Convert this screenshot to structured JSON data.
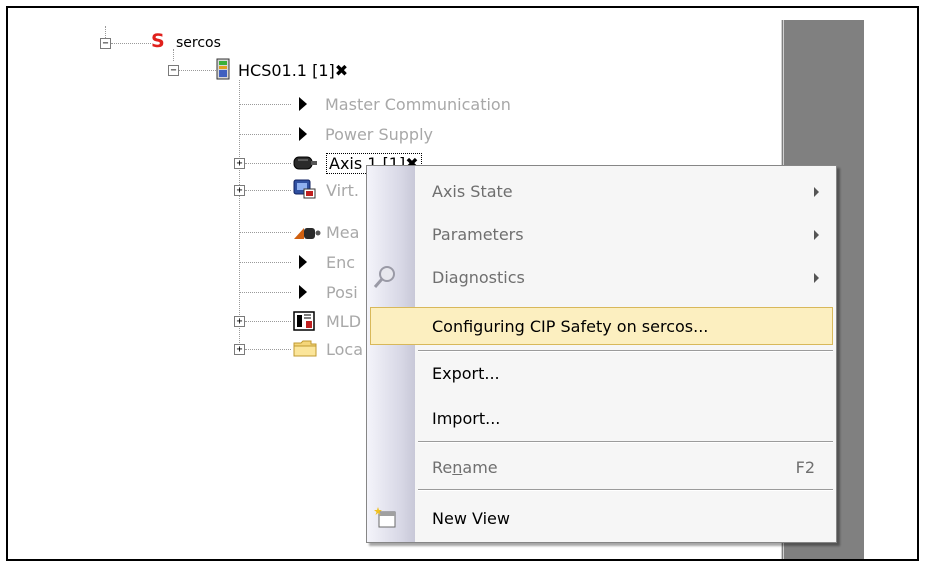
{
  "tree": {
    "root": {
      "icon": "sercos-s-icon",
      "label": "sercos",
      "icon_color": "#e0201c"
    },
    "drive": {
      "icon": "drive-device-icon",
      "label": "HCS01.1 [1]✖"
    },
    "children": [
      {
        "id": "master",
        "icon": "arrow-right-icon",
        "label": "Master Communication",
        "dim": true
      },
      {
        "id": "power",
        "icon": "arrow-right-icon",
        "label": "Power Supply",
        "dim": true
      },
      {
        "id": "axis",
        "icon": "motor-icon",
        "label": "Axis 1 [1]✖",
        "dim": false,
        "selected": true
      },
      {
        "id": "virt",
        "icon": "virtual-master-icon",
        "label": "Virt.",
        "dim": true
      },
      {
        "id": "meas",
        "icon": "measuring-encoder-icon",
        "label": "Mea",
        "dim": true
      },
      {
        "id": "enc",
        "icon": "arrow-right-icon",
        "label": "Enc",
        "dim": true
      },
      {
        "id": "pos",
        "icon": "arrow-right-icon",
        "label": "Posi",
        "dim": true
      },
      {
        "id": "mld",
        "icon": "mld-icon",
        "label": "MLD",
        "dim": true
      },
      {
        "id": "loc",
        "icon": "folder-icon",
        "label": "Loca",
        "dim": true
      }
    ]
  },
  "context_menu": {
    "items": [
      {
        "label": "Axis State",
        "submenu": true,
        "enabled": true
      },
      {
        "label": "Parameters",
        "submenu": true,
        "enabled": true
      },
      {
        "label": "Diagnostics",
        "submenu": true,
        "enabled": true,
        "icon": "magnifier-icon"
      },
      {
        "label": "Configuring CIP Safety on sercos...",
        "highlighted": true,
        "enabled": true
      },
      {
        "label": "Export...",
        "enabled": true
      },
      {
        "label": "Import...",
        "enabled": true
      },
      {
        "label_pre": "Re",
        "label_u": "n",
        "label_post": "ame",
        "shortcut": "F2",
        "enabled": false
      },
      {
        "label": "New View",
        "enabled": true,
        "icon": "new-view-icon"
      }
    ]
  }
}
